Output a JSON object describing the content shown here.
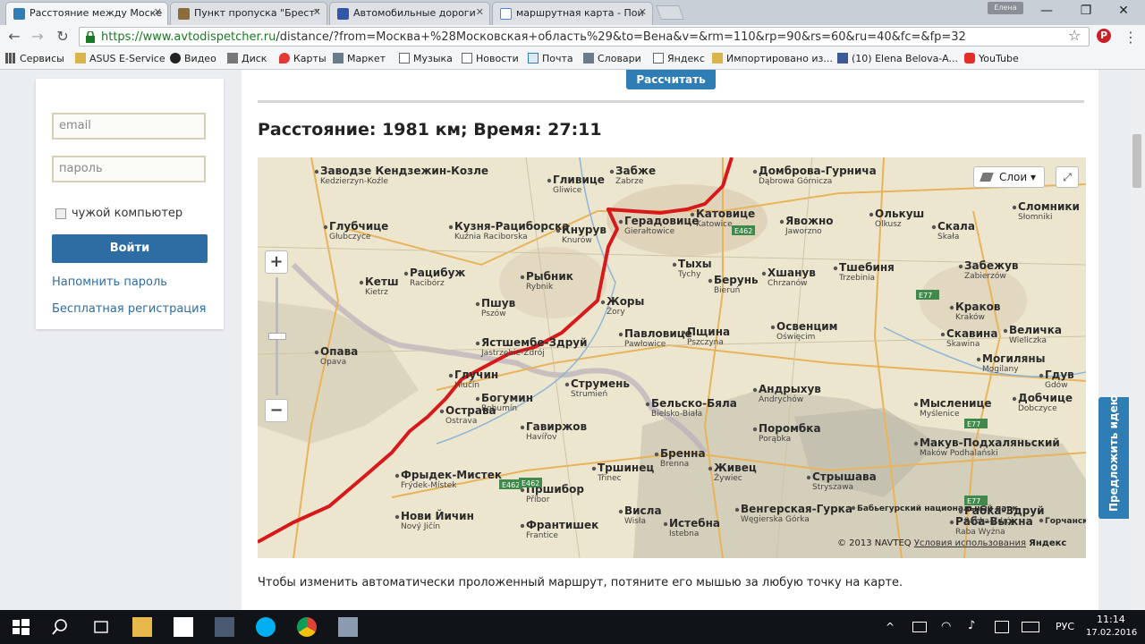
{
  "browser": {
    "tabs": [
      {
        "title": "Расстояние между Моске",
        "favicon_color": "#2e7db5",
        "active": true
      },
      {
        "title": "Пункт пропуска \"Брест\"",
        "favicon_color": "#8b6d3a",
        "active": false
      },
      {
        "title": "Автомобильные дороги",
        "favicon_color": "#3355aa",
        "active": false
      },
      {
        "title": "маршрутная карта - Пои",
        "favicon_color": "#4a86e8",
        "active": false
      }
    ],
    "user_badge": "Елена",
    "window_controls": [
      "—",
      "❐",
      "✕"
    ],
    "url_green": "https://www.avtodispetcher.ru",
    "url_rest": "/distance/?from=Москва+%28Московская+область%29&to=Вена&v=&rm=110&rp=90&rs=60&ru=40&fc=&fp=32",
    "bookmarks": [
      {
        "label": "Сервисы",
        "icon": "apps-grid-icon"
      },
      {
        "label": "ASUS E-Service",
        "icon": "folder-icon"
      },
      {
        "label": "Видео",
        "icon": "video-icon"
      },
      {
        "label": "Диск",
        "icon": "disk-icon"
      },
      {
        "label": "Карты",
        "icon": "map-pin-icon"
      },
      {
        "label": "Маркет",
        "icon": "market-icon"
      },
      {
        "label": "Музыка",
        "icon": "page-icon"
      },
      {
        "label": "Новости",
        "icon": "page-icon"
      },
      {
        "label": "Почта",
        "icon": "mail-icon"
      },
      {
        "label": "Словари",
        "icon": "dictionary-icon"
      },
      {
        "label": "Яндекс",
        "icon": "page-icon"
      },
      {
        "label": "Импортировано из...",
        "icon": "folder-icon"
      },
      {
        "label": "(10) Elena Belova-A...",
        "icon": "facebook-icon"
      },
      {
        "label": "YouTube",
        "icon": "youtube-icon"
      }
    ]
  },
  "login": {
    "email_placeholder": "email",
    "password_placeholder": "пароль",
    "foreign_computer_label": "чужой компьютер",
    "login_button": "Войти",
    "remind_password": "Напомнить пароль",
    "register": "Бесплатная регистрация"
  },
  "main": {
    "calculate_button": "Рассчитать",
    "distance_title": "Расстояние: 1981 км; Время: 27:11",
    "hint": "Чтобы изменить автоматически проложенный маршрут, потяните его мышью за любую точку на карте.",
    "suggest_idea": "Предложить идею"
  },
  "map": {
    "layers_label": "Слои",
    "copyright": "© 2013 NAVTEQ",
    "terms": "Условия использования",
    "yandex": "Яндекс",
    "route_color": "#d7191c",
    "cities": [
      {
        "name": "Заводзе Кендзежин-Козле",
        "sub": "Kedzierzyn-Koźle"
      },
      {
        "name": "Гливице",
        "sub": "Gliwice"
      },
      {
        "name": "Забже",
        "sub": "Zabrze"
      },
      {
        "name": "Домброва-Гурнича",
        "sub": "Dąbrowa Górnicza"
      },
      {
        "name": "Катовице",
        "sub": "Katowice"
      },
      {
        "name": "Олькуш",
        "sub": "Olkusz"
      },
      {
        "name": "Сломники",
        "sub": "Słomniki"
      },
      {
        "name": "Глубчице",
        "sub": "Głubczyce"
      },
      {
        "name": "Кузня-Рациборска",
        "sub": "Kuźnia Raciborska"
      },
      {
        "name": "Кнурув",
        "sub": "Knurów"
      },
      {
        "name": "Герадовице",
        "sub": "Gierałtowice"
      },
      {
        "name": "Явожно",
        "sub": "Jaworzno"
      },
      {
        "name": "Скала",
        "sub": "Skała"
      },
      {
        "name": "Рацибуж",
        "sub": "Racibórz"
      },
      {
        "name": "Рыбник",
        "sub": "Rybnik"
      },
      {
        "name": "Тыхы",
        "sub": "Tychy"
      },
      {
        "name": "Хшанув",
        "sub": "Chrzanów"
      },
      {
        "name": "Тшебиня",
        "sub": "Trzebinia"
      },
      {
        "name": "Забежув",
        "sub": "Zabierzów"
      },
      {
        "name": "Кетш",
        "sub": "Kietrz"
      },
      {
        "name": "Пшув",
        "sub": "Pszów"
      },
      {
        "name": "Жоры",
        "sub": "Żory"
      },
      {
        "name": "Берунь",
        "sub": "Bieruń"
      },
      {
        "name": "Краков",
        "sub": "Kraków"
      },
      {
        "name": "Ястшембе-Здруй",
        "sub": "Jastrzębie-Zdrój"
      },
      {
        "name": "Павловице",
        "sub": "Pawłowice"
      },
      {
        "name": "Пщина",
        "sub": "Pszczyna"
      },
      {
        "name": "Освенцим",
        "sub": "Oświęcim"
      },
      {
        "name": "Скавина",
        "sub": "Skawina"
      },
      {
        "name": "Величка",
        "sub": "Wieliczka"
      },
      {
        "name": "Опава",
        "sub": "Opava"
      },
      {
        "name": "Глучин",
        "sub": "Hlučín"
      },
      {
        "name": "Богумин",
        "sub": "Bohumín"
      },
      {
        "name": "Струмень",
        "sub": "Strumień"
      },
      {
        "name": "Андрыхув",
        "sub": "Andrychów"
      },
      {
        "name": "Могиляны",
        "sub": "Mogilany"
      },
      {
        "name": "Гдув",
        "sub": "Gdów"
      },
      {
        "name": "Острава",
        "sub": "Ostrava"
      },
      {
        "name": "Бельско-Бяла",
        "sub": "Bielsko-Biała"
      },
      {
        "name": "Мысленице",
        "sub": "Myślenice"
      },
      {
        "name": "Добчице",
        "sub": "Dobczyce"
      },
      {
        "name": "Гавиржов",
        "sub": "Havířov"
      },
      {
        "name": "Поромбка",
        "sub": "Porąbka"
      },
      {
        "name": "Фрыдек-Мистек",
        "sub": "Frýdek-Místek"
      },
      {
        "name": "Тршинец",
        "sub": "Třinec"
      },
      {
        "name": "Бренна",
        "sub": "Brenna"
      },
      {
        "name": "Живец",
        "sub": "Żywiec"
      },
      {
        "name": "Стрышава",
        "sub": "Stryszawa"
      },
      {
        "name": "Макув-Подхаляньский",
        "sub": "Maków Podhalański"
      },
      {
        "name": "Венгерская-Гурка",
        "sub": "Węgierska Górka"
      },
      {
        "name": "Бабьегурский национальный парк",
        "sub": ""
      },
      {
        "name": "Раба-Выжна",
        "sub": "Raba Wyżna"
      },
      {
        "name": "Рабка-Здруй",
        "sub": "Rabka-Zdrój"
      },
      {
        "name": "Горчанский национальный парк",
        "sub": ""
      },
      {
        "name": "Нови Йичин",
        "sub": "Nový Jičín"
      },
      {
        "name": "Висла",
        "sub": "Wisła"
      },
      {
        "name": "Истебна",
        "sub": "Istebna"
      },
      {
        "name": "Пршибор",
        "sub": "Příbor"
      },
      {
        "name": "Франтишек",
        "sub": "Frantice"
      }
    ],
    "road_shields": [
      "E462",
      "E462",
      "E462",
      "E77",
      "E77",
      "E77"
    ]
  },
  "taskbar": {
    "lang": "РУС",
    "time": "11:14",
    "date": "17.02.2016"
  }
}
